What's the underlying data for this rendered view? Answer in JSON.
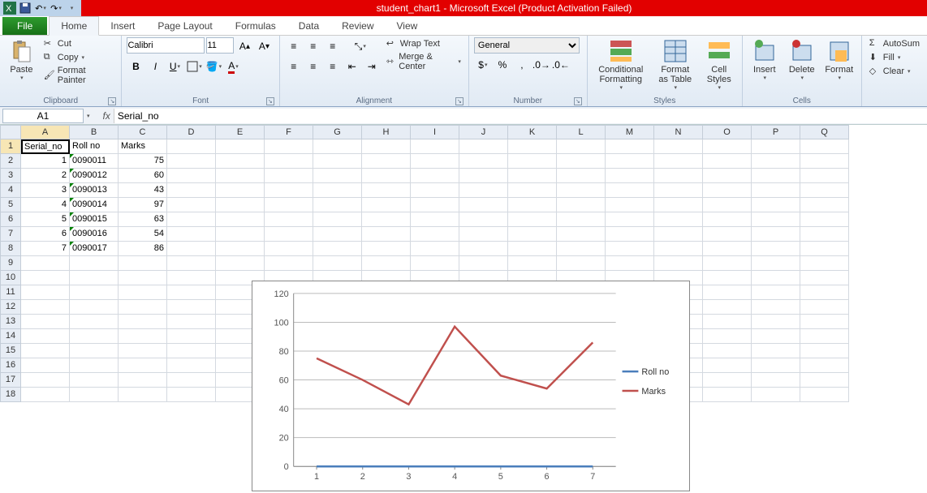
{
  "app": {
    "title": "student_chart1 - Microsoft Excel (Product Activation Failed)"
  },
  "tabs": {
    "file": "File",
    "list": [
      "Home",
      "Insert",
      "Page Layout",
      "Formulas",
      "Data",
      "Review",
      "View"
    ],
    "active": "Home"
  },
  "ribbon": {
    "clipboard": {
      "label": "Clipboard",
      "paste": "Paste",
      "cut": "Cut",
      "copy": "Copy",
      "fmtpaint": "Format Painter"
    },
    "font": {
      "label": "Font",
      "name": "Calibri",
      "size": "11"
    },
    "align": {
      "label": "Alignment",
      "wrap": "Wrap Text",
      "merge": "Merge & Center"
    },
    "number": {
      "label": "Number",
      "format": "General"
    },
    "styles": {
      "label": "Styles",
      "cond": "Conditional Formatting",
      "table": "Format as Table",
      "cell": "Cell Styles"
    },
    "cells": {
      "label": "Cells",
      "insert": "Insert",
      "delete": "Delete",
      "format": "Format"
    },
    "edit": {
      "sum": "AutoSum",
      "fill": "Fill",
      "clear": "Clear"
    }
  },
  "namebox": "A1",
  "formula": "Serial_no",
  "columns": [
    "A",
    "B",
    "C",
    "D",
    "E",
    "F",
    "G",
    "H",
    "I",
    "J",
    "K",
    "L",
    "M",
    "N",
    "O",
    "P",
    "Q"
  ],
  "numrows": 18,
  "headers": {
    "a": "Serial_no",
    "b": "Roll no",
    "c": "Marks"
  },
  "rowsdata": [
    {
      "s": "1",
      "r": "0090011",
      "m": "75"
    },
    {
      "s": "2",
      "r": "0090012",
      "m": "60"
    },
    {
      "s": "3",
      "r": "0090013",
      "m": "43"
    },
    {
      "s": "4",
      "r": "0090014",
      "m": "97"
    },
    {
      "s": "5",
      "r": "0090015",
      "m": "63"
    },
    {
      "s": "6",
      "r": "0090016",
      "m": "54"
    },
    {
      "s": "7",
      "r": "0090017",
      "m": "86"
    }
  ],
  "chart_data": {
    "type": "line",
    "categories": [
      1,
      2,
      3,
      4,
      5,
      6,
      7
    ],
    "series": [
      {
        "name": "Roll no",
        "values": [
          0,
          0,
          0,
          0,
          0,
          0,
          0
        ],
        "color": "#4a7ebb"
      },
      {
        "name": "Marks",
        "values": [
          75,
          60,
          43,
          97,
          63,
          54,
          86
        ],
        "color": "#c0504d"
      }
    ],
    "ylim": [
      0,
      120
    ],
    "ytick": 20,
    "title": "",
    "xlabel": "",
    "ylabel": ""
  }
}
